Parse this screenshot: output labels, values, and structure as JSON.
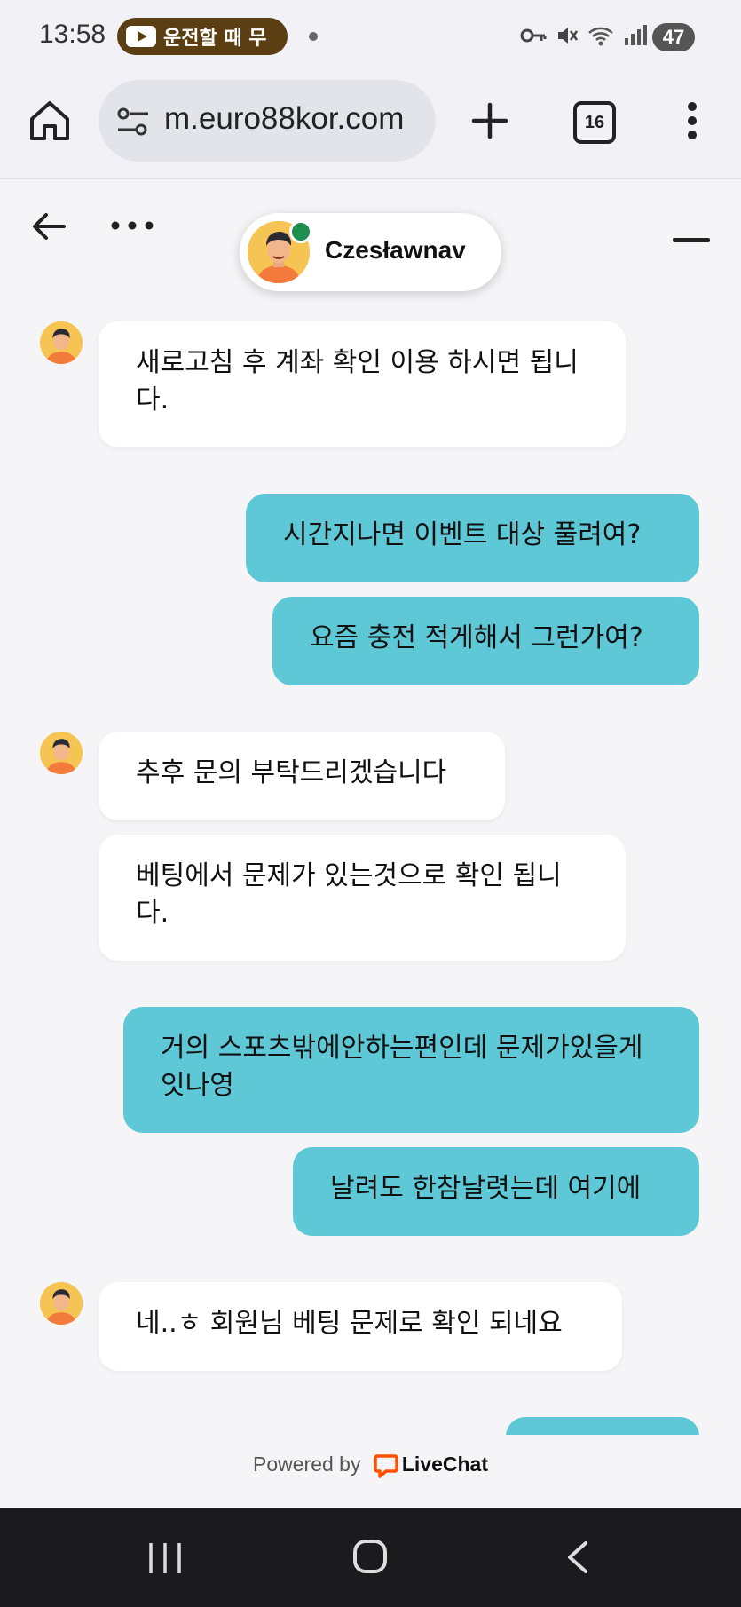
{
  "status_bar": {
    "time": "13:58",
    "driving_label": "운전할 때 무",
    "battery": "47"
  },
  "browser": {
    "url": "m.euro88kor.com",
    "tab_count": "16"
  },
  "chat": {
    "agent_name": "Czesławnav",
    "messages": [
      {
        "from": "agent",
        "text": "새로고침 후 계좌 확인 이용 하시면 됩니다."
      },
      {
        "from": "user",
        "text": "시간지나면 이벤트 대상 풀려여?"
      },
      {
        "from": "user",
        "text": "요즘 충전 적게해서 그런가여?"
      },
      {
        "from": "agent",
        "text": "추후 문의 부탁드리겠습니다"
      },
      {
        "from": "agent",
        "text": "베팅에서 문제가 있는것으로 확인 됩니다."
      },
      {
        "from": "user",
        "text": "거의 스포츠밖에안하는편인데 문제가있을게잇나영"
      },
      {
        "from": "user",
        "text": "날려도 한참날렷는데 여기에"
      },
      {
        "from": "agent",
        "text": "네..ㅎ 회원님 베팅 문제로 확인 되네요"
      }
    ]
  },
  "footer": {
    "powered_by": "Powered by",
    "brand": "LiveChat"
  },
  "colors": {
    "user_bubble": "#5ec8d6",
    "agent_bubble": "#ffffff",
    "online": "#1e8f4d",
    "livechat_orange": "#ff5100"
  }
}
